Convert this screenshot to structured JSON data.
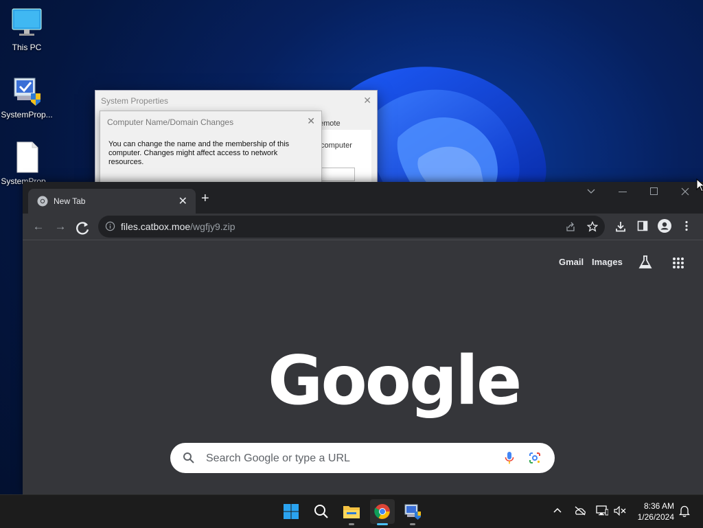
{
  "desktop": {
    "icons": [
      {
        "label": "This PC",
        "icon": "monitor-icon"
      },
      {
        "label": "SystemProp...",
        "icon": "system-properties-icon"
      },
      {
        "label": "SystemProp...",
        "icon": "document-icon"
      }
    ]
  },
  "system_properties": {
    "title": "System Properties",
    "peek_text_1": "emote",
    "peek_text_2": "computer"
  },
  "name_domain_dialog": {
    "title": "Computer Name/Domain Changes",
    "body": "You can change the name and the membership of this computer. Changes might affect access to network resources."
  },
  "chrome": {
    "tab_title": "New Tab",
    "url_host": "files.catbox.moe",
    "url_path": "/wgfjy9.zip",
    "ntp": {
      "gmail": "Gmail",
      "images": "Images",
      "logo": "Google",
      "search_placeholder": "Search Google or type a URL"
    }
  },
  "taskbar": {
    "apps": [
      "start-icon",
      "search-icon",
      "file-explorer-icon",
      "chrome-icon",
      "system-properties-icon"
    ],
    "time": "8:36 AM",
    "date": "1/26/2024"
  },
  "colors": {
    "chrome_dark": "#202124",
    "chrome_toolbar": "#35363a",
    "accent": "#4cc2ff"
  }
}
